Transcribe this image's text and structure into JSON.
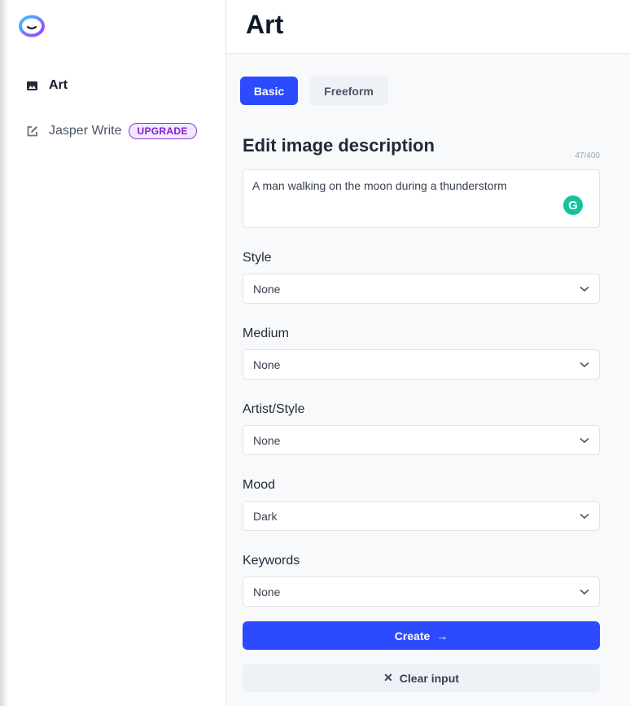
{
  "sidebar": {
    "items": [
      {
        "label": "Art",
        "icon": "image-icon"
      },
      {
        "label": "Jasper Write",
        "icon": "edit-icon",
        "badge": "UPGRADE"
      }
    ]
  },
  "header": {
    "title": "Art"
  },
  "tabs": [
    {
      "label": "Basic",
      "active": true
    },
    {
      "label": "Freeform",
      "active": false
    }
  ],
  "form": {
    "heading": "Edit image description",
    "counter": "47/400",
    "description": "A man walking on the moon during a thunderstorm",
    "fields": [
      {
        "label": "Style",
        "value": "None"
      },
      {
        "label": "Medium",
        "value": "None"
      },
      {
        "label": "Artist/Style",
        "value": "None"
      },
      {
        "label": "Mood",
        "value": "Dark"
      },
      {
        "label": "Keywords",
        "value": "None"
      }
    ],
    "create_label": "Create",
    "clear_label": "Clear input"
  },
  "colors": {
    "primary": "#2c4bff",
    "upgrade": "#7e22ce",
    "grammarly": "#15c39a"
  }
}
